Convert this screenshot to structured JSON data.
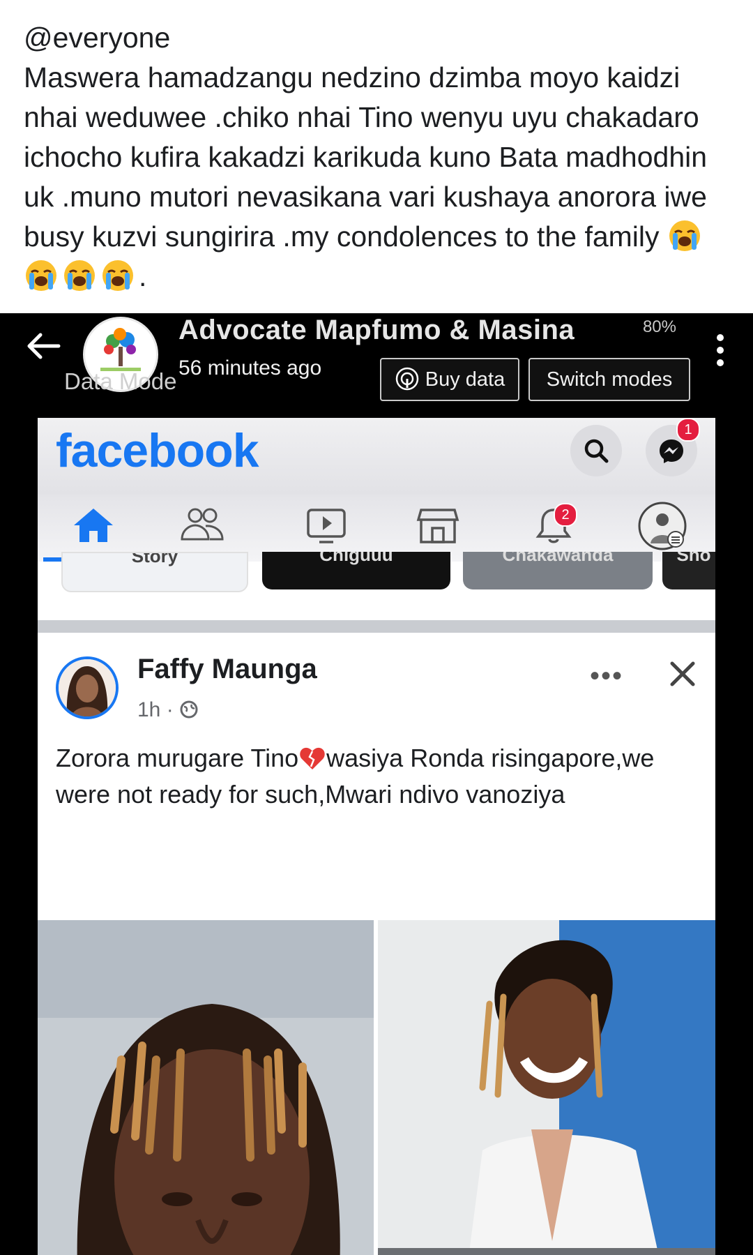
{
  "caption": {
    "mention": "@everyone",
    "body": "Maswera hamadzangu nedzino dzimba moyo kaidzi nhai weduwee .chiko nhai Tino wenyu uyu chakadaro ichocho kufira kakadzi karikuda kuno Bata madhodhin uk .muno mutori nevasikana vari kushaya anorora iwe busy kuzvi sungirira .my condolences to the family",
    "trailing_emojis": [
      "loudly-crying-face",
      "loudly-crying-face",
      "loudly-crying-face",
      "loudly-crying-face"
    ],
    "end": "."
  },
  "overlay": {
    "page_name": "Advocate Mapfumo & Masina",
    "time_ago": "56 minutes ago",
    "data_mode_label": "Data Mode",
    "battery": "80%",
    "buy_data_label": "Buy data",
    "switch_modes_label": "Switch modes"
  },
  "facebook": {
    "logo": "facebook",
    "messenger_badge": "1",
    "notifications_badge": "2",
    "tabs": [
      "home-icon",
      "friends-icon",
      "watch-icon",
      "marketplace-icon",
      "notifications-icon",
      "profile-menu-icon"
    ],
    "stories": [
      "Story",
      "Chiguuu",
      "Chakawanda",
      "Sho"
    ],
    "post": {
      "author": "Faffy Maunga",
      "meta": "1h ·",
      "text_before_heart": "Zorora murugare Tino",
      "text_after_heart": "wasiya Ronda risingapore,we were not ready for such,Mwari ndivo vanoziya"
    }
  },
  "colors": {
    "facebook_blue": "#1877f2",
    "badge_red": "#e41e3f",
    "screenshot_bg": "#000000"
  }
}
